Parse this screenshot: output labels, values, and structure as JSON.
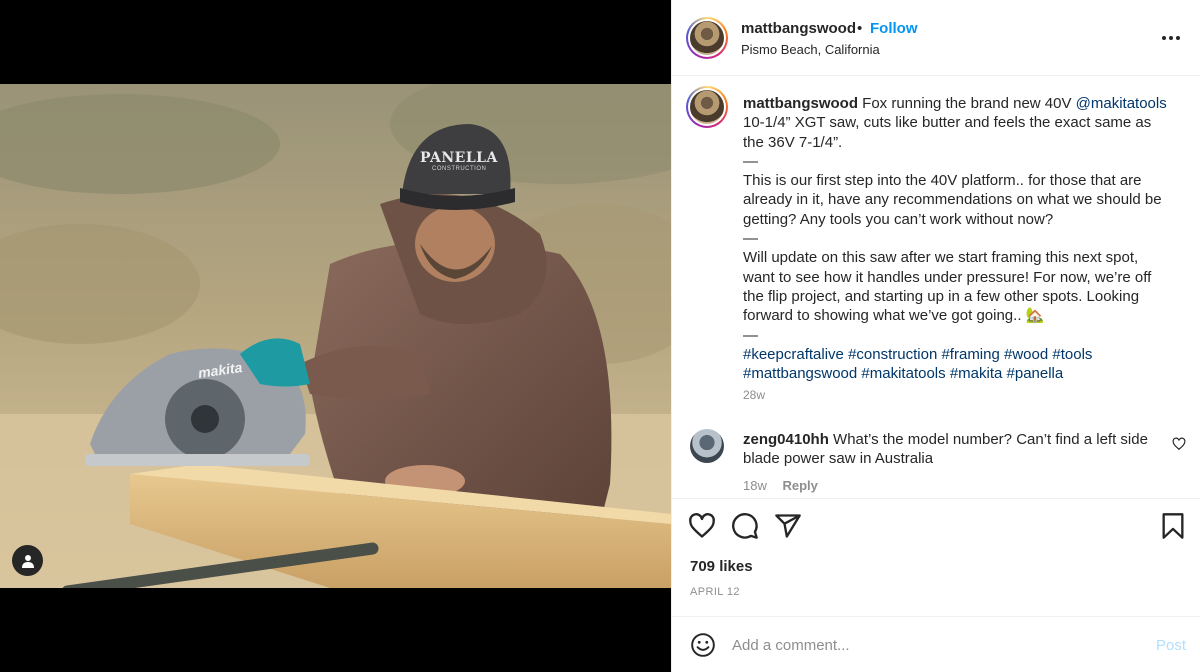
{
  "post": {
    "username": "mattbangswood",
    "separator": "•",
    "follow_label": "Follow",
    "location": "Pismo Beach, California",
    "hat_text": "PANELLA",
    "hat_subtext": "CONSTRUCTION",
    "saw_brand": "makita"
  },
  "caption": {
    "username": "mattbangswood",
    "line1_text": " Fox running the brand new 40V ",
    "mention": "@makitatools",
    "line1_rest": " 10-1/4” XGT saw, cuts like butter and feels the exact same as the 36V 7-1/4”.",
    "dash1": "—",
    "para2": "This is our first step into the 40V platform.. for those that are already in it, have any recommendations on what we should be getting? Any tools you can’t work without now?",
    "dash2": "—",
    "para3": "Will update on this saw after we start framing this next spot, want to see how it handles under pressure! For now, we’re off the flip project, and starting up in a few other spots. Looking forward to showing what we’ve got going.. 🏡",
    "dash3": "—",
    "hashtags": [
      "#keepcraftalive",
      "#construction",
      "#framing",
      "#wood",
      "#tools",
      "#mattbangswood",
      "#makitatools",
      "#makita",
      "#panella"
    ],
    "time": "28w"
  },
  "comment": {
    "username": "zeng0410hh",
    "text": " What’s the model number? Can’t find a left side blade power saw in Australia",
    "time": "18w",
    "reply_label": "Reply"
  },
  "actions": {
    "likes": "709 likes",
    "date": "APRIL 12"
  },
  "add_comment": {
    "placeholder": "Add a comment...",
    "post_label": "Post"
  },
  "colors": {
    "link": "#0095f6",
    "hashtag": "#00376b",
    "muted": "#8e8e8e",
    "post_disabled": "#b2dffc"
  }
}
